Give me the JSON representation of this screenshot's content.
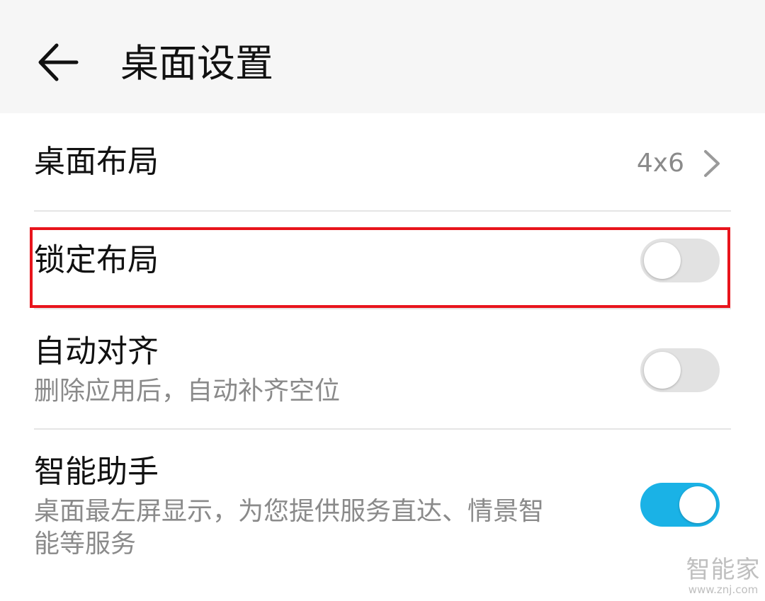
{
  "header": {
    "title": "桌面设置",
    "back_icon": "arrow-left-icon"
  },
  "settings": {
    "layout": {
      "title": "桌面布局",
      "value": "4x6",
      "icon": "chevron-right-icon"
    },
    "lock_layout": {
      "title": "锁定布局",
      "enabled": false
    },
    "auto_align": {
      "title": "自动对齐",
      "subtitle": "删除应用后，自动补齐空位",
      "enabled": false
    },
    "smart_assistant": {
      "title": "智能助手",
      "subtitle_line1": "桌面最左屏显示，为您提供服务直达、情景智",
      "subtitle_line2": "能等服务",
      "enabled": true
    }
  },
  "annotation": {
    "highlight_color": "#e8141c"
  },
  "colors": {
    "toggle_on": "#1ab2e6",
    "toggle_off": "#e2e2e2",
    "header_bg": "#f6f6f6"
  },
  "watermark": {
    "logo": "智能家",
    "url": "www.znj.com"
  }
}
